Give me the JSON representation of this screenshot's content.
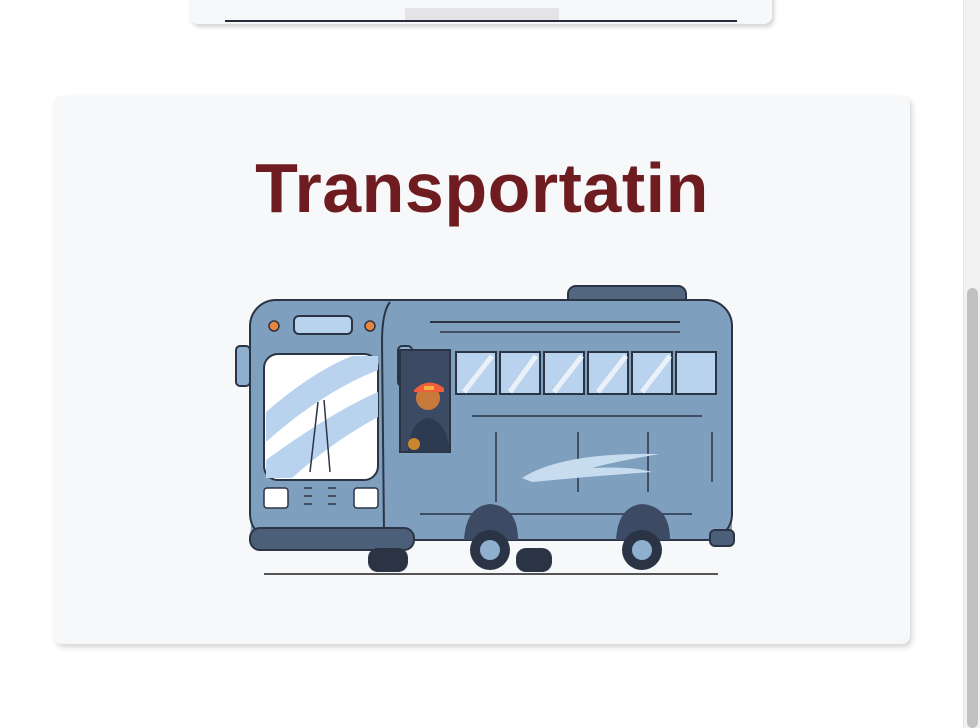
{
  "card": {
    "title": "Transportatin",
    "illustration_icon": "bus-illustration-icon"
  },
  "colors": {
    "title": "#6e1c1f",
    "card_bg": "#f7f8fa",
    "bus_body": "#7f9fbf"
  }
}
